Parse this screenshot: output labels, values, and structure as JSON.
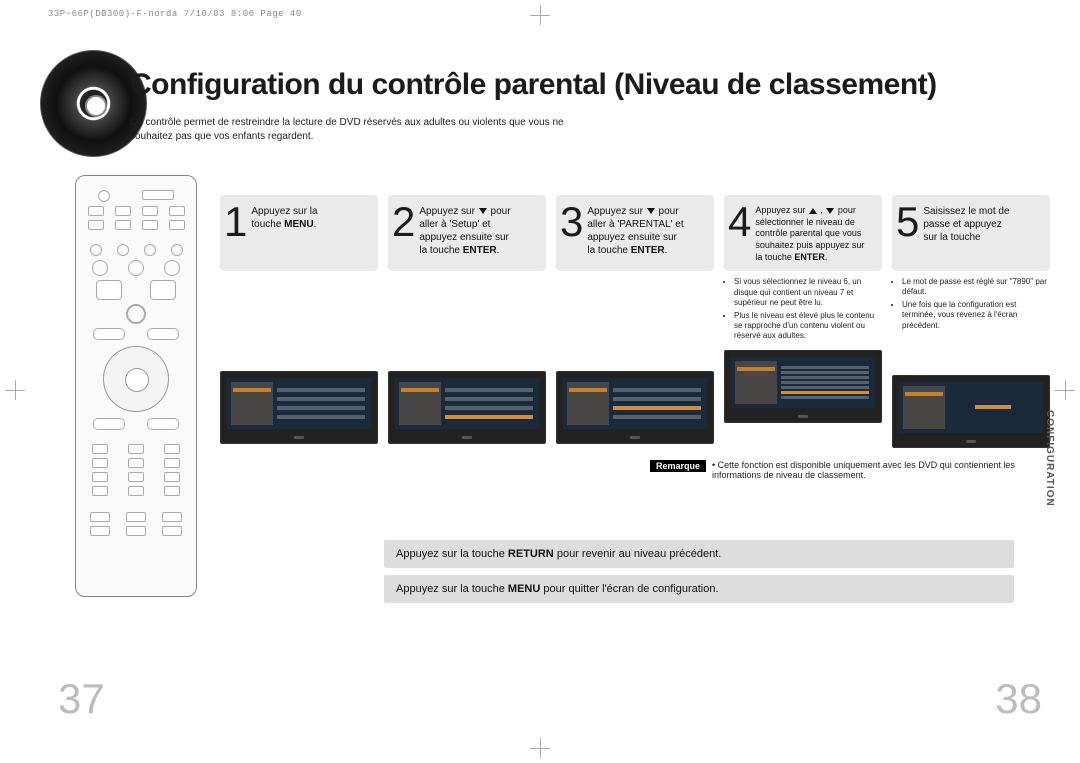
{
  "print_header": "33P~66P(DB300)-F-norda  7/10/03 8:06  Page 40",
  "title": "Configuration du contrôle parental (Niveau de classement)",
  "subtitle": "Ce contrôle permet de restreindre la lecture de DVD réservés aux adultes ou violents que vous ne souhaitez pas que vos enfants regardent.",
  "sidetab": "CONFIGURATION",
  "steps": [
    {
      "num": "1",
      "line1": "Appuyez sur la",
      "line2": "touche ",
      "bold": "MENU",
      "suffix": ".",
      "bullets": []
    },
    {
      "num": "2",
      "line1": "Appuyez sur ▾ pour",
      "line2": "aller à 'Setup' et",
      "line3": "appuyez ensuite sur",
      "line4": "la touche ",
      "bold": "ENTER",
      "suffix": ".",
      "bullets": []
    },
    {
      "num": "3",
      "line1": "Appuyez sur ▾ pour",
      "line2": "aller à 'PARENTAL' et",
      "line3": "appuyez ensuite sur",
      "line4": "la touche ",
      "bold": "ENTER",
      "suffix": ".",
      "bullets": []
    },
    {
      "num": "4",
      "line1": "Appuyez sur ▴ , ▾ pour",
      "line2": "sélectionner le niveau de",
      "line3": "contrôle parental que vous",
      "line4": "souhaitez puis appuyez sur",
      "line5": "la touche ",
      "bold": "ENTER",
      "suffix": ".",
      "bullets": [
        "Si vous sélectionnez le niveau 6, un disque qui contient un niveau 7 et supérieur ne peut être lu.",
        "Plus le niveau est élevé plus le contenu se rapproche d'un contenu violent ou réservé aux adultes."
      ]
    },
    {
      "num": "5",
      "line1": "Saisissez le mot de",
      "line2": "passe et appuyez",
      "line3": "sur la touche",
      "bullets": [
        "Le mot de passe est réglé sur \"7890\" par défaut.",
        "Une fois que la configuration est terminée, vous revenez à l'écran précédent."
      ]
    }
  ],
  "remarque": {
    "label": "Remarque",
    "text": "Cette fonction est disponible uniquement avec les DVD qui contiennent les informations de niveau de classement."
  },
  "footer1": {
    "pre": "Appuyez sur la touche ",
    "bold": "RETURN",
    "post": " pour revenir au niveau précédent."
  },
  "footer2": {
    "pre": "Appuyez sur la touche ",
    "bold": "MENU",
    "post": " pour quitter l'écran de configuration."
  },
  "page_left": "37",
  "page_right": "38"
}
